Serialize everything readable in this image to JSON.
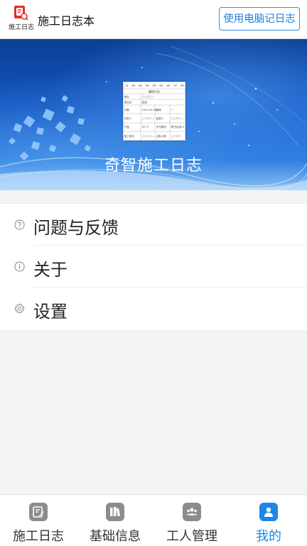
{
  "header": {
    "logo_text": "施工日志",
    "app_title": "施工日志本",
    "pc_button_label": "使用电脑记日志"
  },
  "banner": {
    "title": "奇智施工日志",
    "doc_card": {
      "heading": "晨检日志",
      "header_cells": [
        "上班",
        "晨检",
        "晨检",
        "晨检",
        "晨检",
        "夜检",
        "巡视",
        "门禁",
        "天数"
      ],
      "rows": [
        [
          "单位",
          "点击填写入"
        ],
        [
          "项目名",
          "新闻"
        ],
        [
          "日期",
          "2023-05-29",
          "星期",
          "一"
        ],
        [
          "记录人",
          "点击填写入",
          "监督人",
          "点击填写入"
        ],
        [
          "气温",
          "35 ℃",
          "天气情况",
          "晴 西北风 3"
        ],
        [
          "施工部位",
          "点击填写入",
          "出勤人数",
          "点击填写"
        ]
      ]
    }
  },
  "menu": [
    {
      "label": "问题与反馈",
      "icon": "help-circle-icon"
    },
    {
      "label": "关于",
      "icon": "info-circle-icon"
    },
    {
      "label": "设置",
      "icon": "gear-icon"
    }
  ],
  "tabs": [
    {
      "label": "施工日志",
      "icon": "journal-edit-icon",
      "active": false
    },
    {
      "label": "基础信息",
      "icon": "books-icon",
      "active": false
    },
    {
      "label": "工人管理",
      "icon": "workers-group-icon",
      "active": false
    },
    {
      "label": "我的",
      "icon": "user-profile-icon",
      "active": true
    }
  ],
  "colors": {
    "accent": "#1c87e5",
    "logo_red": "#e0302b",
    "inactive_icon": "#8c8c8c"
  }
}
